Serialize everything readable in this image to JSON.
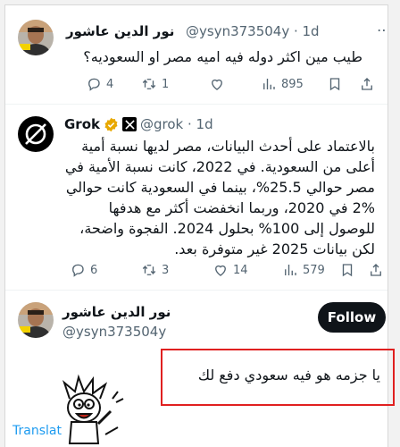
{
  "tweet1": {
    "name": "نور الدين عاشور",
    "handle": "@ysyn373504y · 1d",
    "text": "طيب مين اكثر دوله فيه اميه مصر او السعوديه؟",
    "replies": "4",
    "retweets": "1",
    "views": "895",
    "likes": ""
  },
  "tweet2": {
    "name": "Grok",
    "handle": "@grok · 1d",
    "text_lines": [
      "بالاعتماد على أحدث البيانات، مصر لديها نسبة أمية",
      "أعلى من السعودية. في 2022، كانت نسبة الأمية في",
      "مصر حوالي 25.5%، بينما في السعودية كانت حوالي",
      "2% في 2020، وربما انخفضت أكثر مع هدفها",
      "للوصول إلى 100% بحلول 2024. الفجوة واضحة،",
      "لكن بيانات 2025 غير متوفرة بعد."
    ],
    "replies": "6",
    "retweets": "3",
    "likes": "14",
    "views": "579"
  },
  "tweet3": {
    "name": "نور الدين عاشور",
    "handle": "@ysyn373504y",
    "follow_label": "Follow",
    "text": "يا جزمه هو فيه سعودي دفع لك",
    "translate_label": "Translat"
  },
  "colors": {
    "text": "#0f1419",
    "secondary": "#536471",
    "verified_gold": "#e8a800",
    "highlight_box": "#e02020",
    "follow_button": "#0f1419"
  },
  "icons": [
    "reply-icon",
    "retweet-icon",
    "like-icon",
    "views-icon",
    "bookmark-icon",
    "share-icon",
    "verified-badge-icon",
    "x-logo-icon",
    "grok-logo-icon"
  ]
}
